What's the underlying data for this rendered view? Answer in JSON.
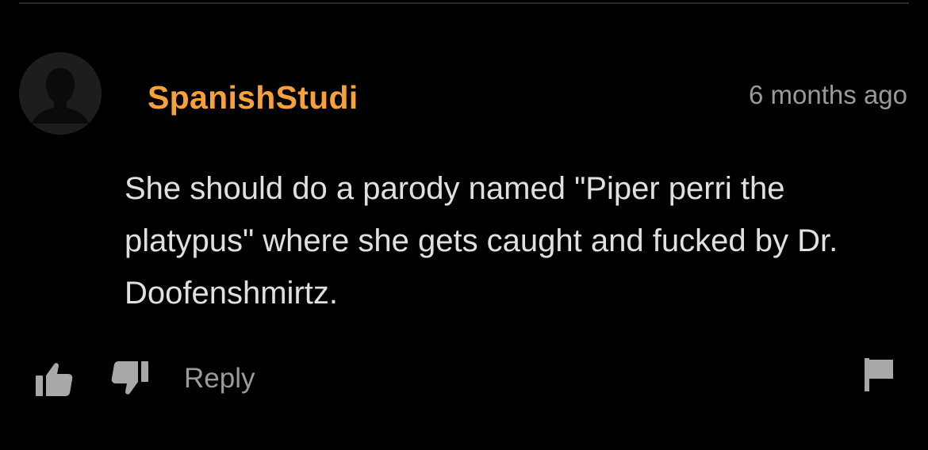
{
  "comment": {
    "username": "SpanishStudi",
    "timestamp": "6 months ago",
    "text": "She should do a parody named \"Piper perri the platypus\" where she gets caught and fucked by Dr. Doofenshmirtz.",
    "avatar_icon": "default-user-silhouette-icon"
  },
  "actions": {
    "like_icon": "thumbs-up-icon",
    "dislike_icon": "thumbs-down-icon",
    "reply_label": "Reply",
    "flag_icon": "flag-icon"
  },
  "colors": {
    "background": "#000000",
    "username": "#f7a13a",
    "text": "#e0e0e0",
    "muted": "#9a9a9a",
    "icon": "#a8a8a8"
  }
}
